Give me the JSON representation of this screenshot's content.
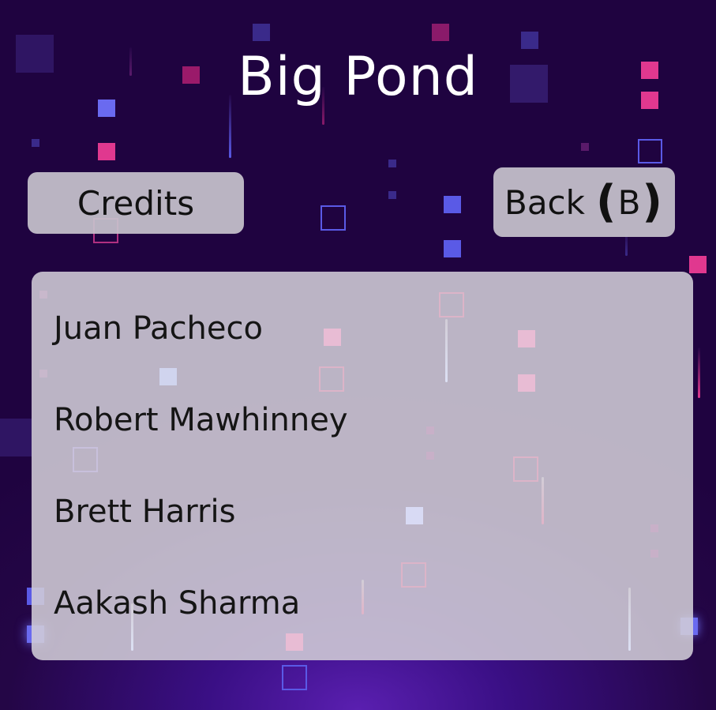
{
  "game": {
    "title": "Big Pond"
  },
  "buttons": {
    "credits_label": "Credits",
    "back_label": "Back",
    "back_key": "B"
  },
  "credits": {
    "names": [
      "Juan Pacheco",
      "Robert Mawhinney",
      "Brett Harris",
      "Aakash Sharma"
    ]
  },
  "colors": {
    "background": "#240646",
    "pink": "#e0388f",
    "blue": "#5a5ae6",
    "panel": "#d2cdd7"
  }
}
